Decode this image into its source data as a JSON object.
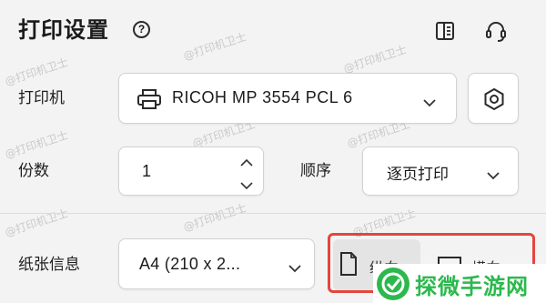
{
  "header": {
    "title": "打印设置",
    "help_glyph": "?",
    "icons": [
      "help-icon",
      "panel-icon",
      "support-icon"
    ]
  },
  "printer": {
    "label": "打印机",
    "value": "RICOH MP 3554 PCL 6",
    "icon": "printer-icon"
  },
  "copies": {
    "label": "份数",
    "value": "1"
  },
  "order": {
    "label": "顺序",
    "value": "逐页打印"
  },
  "paper": {
    "label": "纸张信息",
    "value": "A4 (210 x 2...",
    "orientation": {
      "portrait_label": "纵向",
      "landscape_label": "横向",
      "selected": "portrait"
    }
  },
  "watermark": "@打印机卫士",
  "brand": {
    "name": "探微手游网",
    "logo_glyph": "✓"
  },
  "colors": {
    "highlight": "#e5453f",
    "brand": "#2db84d"
  }
}
